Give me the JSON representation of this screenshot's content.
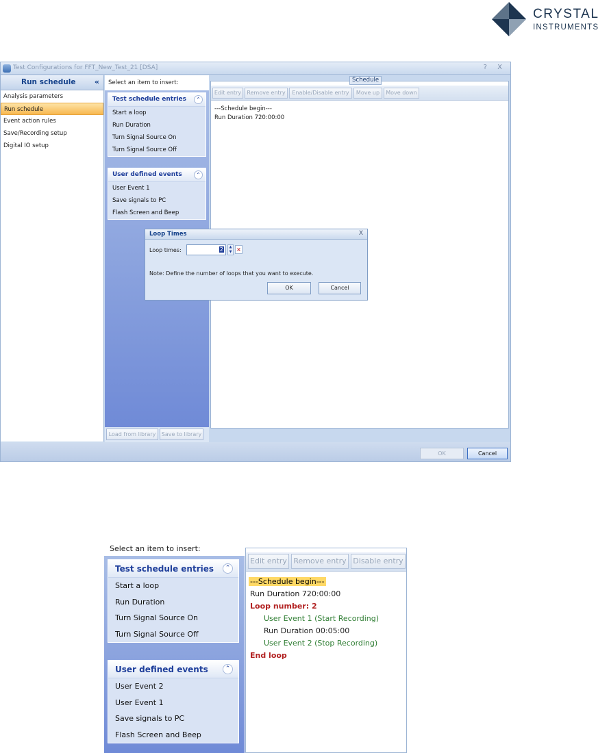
{
  "logo": {
    "line1": "CRYSTAL",
    "line2": "INSTRUMENTS"
  },
  "window": {
    "title": "Test Configurations for FFT_New_Test_21 [DSA]",
    "title_buttons": "? X",
    "nav": {
      "title": "Run schedule",
      "collapse": "«",
      "items": [
        "Analysis parameters",
        "Run schedule",
        "Event action rules",
        "Save/Recording setup",
        "Digital IO setup"
      ]
    },
    "insert_caption": "Select an item to insert:",
    "groups": [
      {
        "title": "Test schedule entries",
        "items": [
          "Start a loop",
          "Run Duration",
          "Turn Signal Source On",
          "Turn Signal Source Off"
        ]
      },
      {
        "title": "User defined events",
        "items": [
          "User Event 1",
          "Save signals to PC",
          "Flash Screen and Beep"
        ]
      }
    ],
    "schedule": {
      "label": "Schedule",
      "toolbar": [
        "Edit entry",
        "Remove entry",
        "Enable/Disable entry",
        "Move up",
        "Move down"
      ],
      "lines": [
        "---Schedule begin---",
        "Run Duration 720:00:00"
      ]
    },
    "library": {
      "load": "Load from library",
      "save": "Save to library"
    },
    "footer": {
      "ok": "OK",
      "cancel": "Cancel"
    }
  },
  "dialog": {
    "title": "Loop Times",
    "close": "X",
    "loop_label": "Loop times:",
    "loop_value": "2",
    "note": "Note: Define the number of loops that you want to execute.",
    "ok": "OK",
    "cancel": "Cancel"
  },
  "crop": {
    "caption": "Select an item to insert:",
    "groups": [
      {
        "title": "Test schedule entries",
        "items": [
          "Start a loop",
          "Run Duration",
          "Turn Signal Source On",
          "Turn Signal Source Off"
        ]
      },
      {
        "title": "User defined events",
        "items": [
          "User Event 2",
          "User Event 1",
          "Save signals to PC",
          "Flash Screen and Beep"
        ]
      }
    ],
    "toolbar": [
      "Edit entry",
      "Remove entry",
      "Disable entry"
    ],
    "lines": [
      {
        "text": "---Schedule begin---",
        "style": "hl"
      },
      {
        "text": "Run Duration 720:00:00",
        "style": "normal"
      },
      {
        "text": "Loop number: 2",
        "style": "loop"
      },
      {
        "text": "User Event 1 (Start Recording)",
        "style": "green"
      },
      {
        "text": "Run Duration 00:05:00",
        "style": "normal"
      },
      {
        "text": "User Event 2 (Stop Recording)",
        "style": "green"
      },
      {
        "text": "End loop",
        "style": "loop"
      }
    ]
  }
}
